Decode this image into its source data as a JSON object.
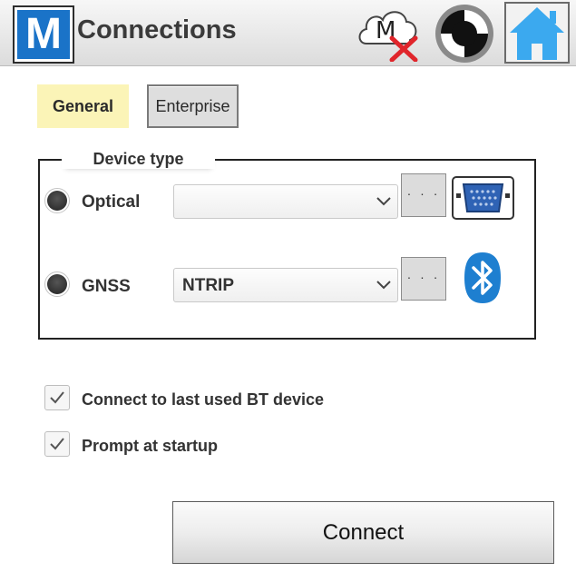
{
  "header": {
    "logo_letter": "M",
    "title": "Connections",
    "cloud_letter": "M",
    "icons": [
      "cloud-offline-icon",
      "sync-status-icon",
      "home-icon"
    ]
  },
  "tabs": [
    {
      "label": "General",
      "selected": true
    },
    {
      "label": "Enterprise",
      "selected": false
    }
  ],
  "device_type": {
    "legend": "Device type",
    "options": [
      {
        "label": "Optical",
        "combo_value": "",
        "button_label": "· · ·",
        "icon": "vga-port-icon"
      },
      {
        "label": "GNSS",
        "combo_value": "NTRIP",
        "button_label": "· · ·",
        "icon": "bluetooth-icon"
      }
    ]
  },
  "checkboxes": [
    {
      "label": "Connect to last used BT device",
      "checked": true
    },
    {
      "label": "Prompt at startup",
      "checked": true
    }
  ],
  "connect_button": {
    "label": "Connect"
  },
  "colors": {
    "brand_blue": "#1a73c8",
    "home_blue": "#3ba9ef",
    "bluetooth_blue": "#1e7fd0",
    "error_red": "#e0252b",
    "selected_tab": "#fbf4b7"
  }
}
